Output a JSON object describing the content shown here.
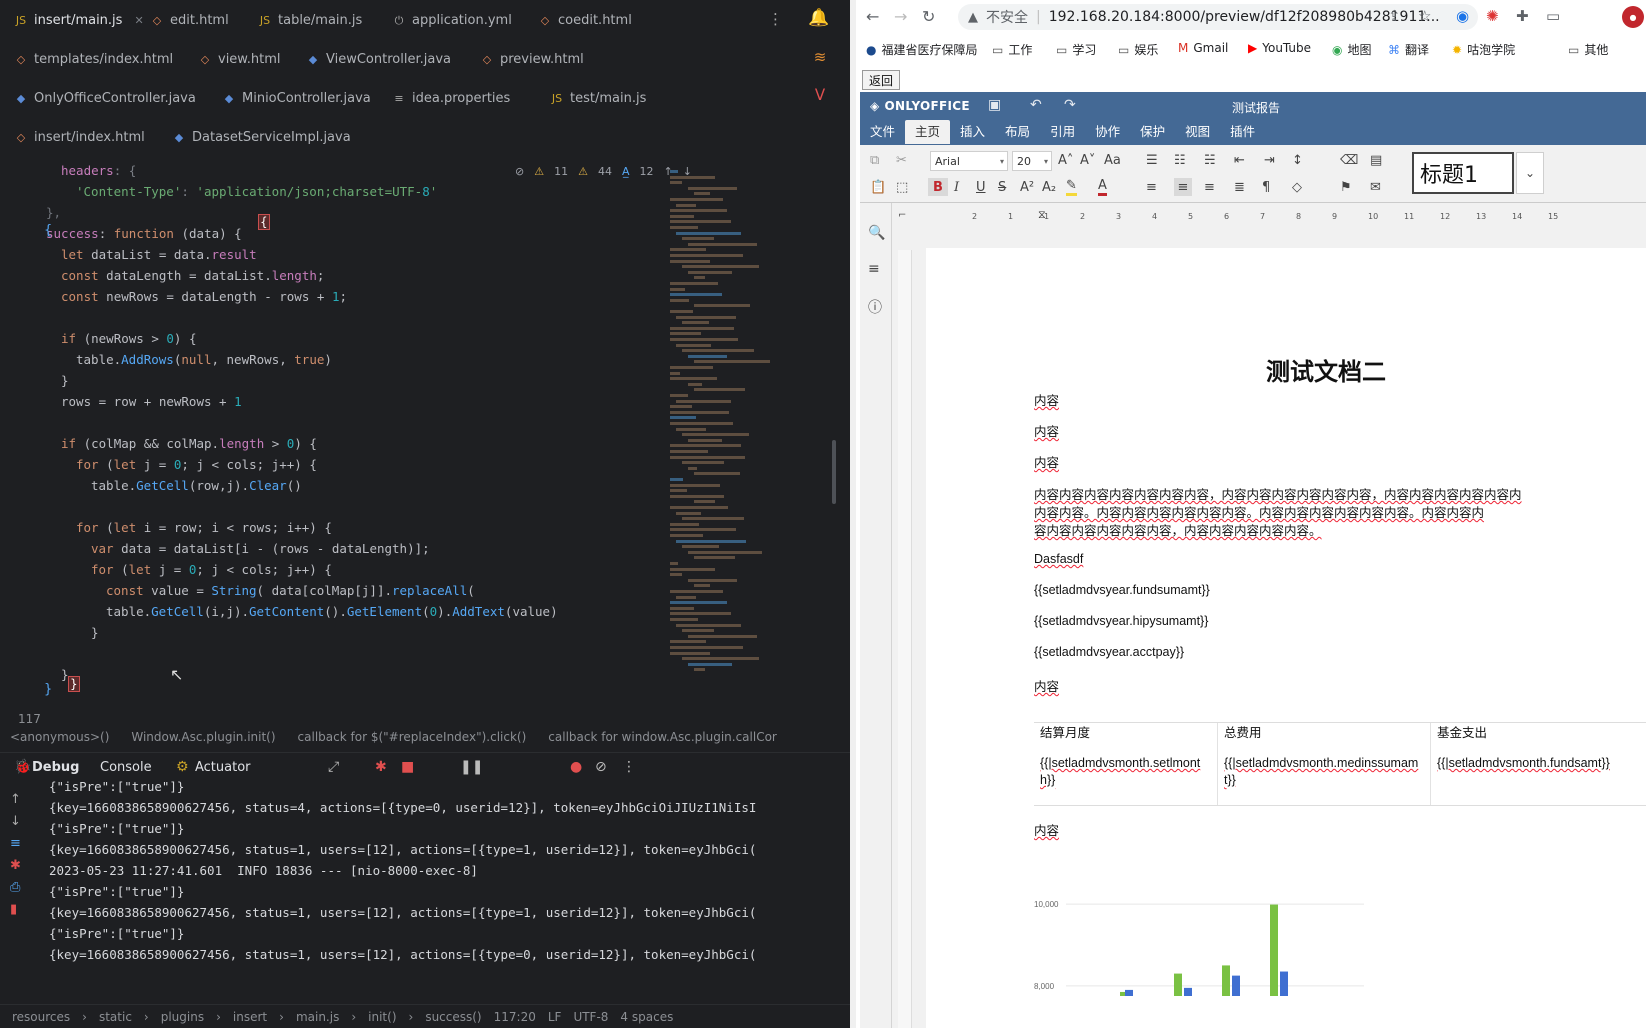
{
  "ide": {
    "tabs_row1": [
      {
        "label": "insert/main.js",
        "icon": "js-file-icon",
        "active": true
      },
      {
        "label": "edit.html",
        "icon": "html-file-icon"
      },
      {
        "label": "table/main.js",
        "icon": "js-file-icon"
      },
      {
        "label": "application.yml",
        "icon": "yml-file-icon"
      },
      {
        "label": "coedit.html",
        "icon": "html-file-icon"
      }
    ],
    "tabs_row2": [
      {
        "label": "templates/index.html",
        "icon": "html-file-icon"
      },
      {
        "label": "view.html",
        "icon": "html-file-icon"
      },
      {
        "label": "ViewController.java",
        "icon": "java-file-icon"
      },
      {
        "label": "preview.html",
        "icon": "html-file-icon"
      }
    ],
    "tabs_row3": [
      {
        "label": "OnlyOfficeController.java",
        "icon": "java-file-icon"
      },
      {
        "label": "MinioController.java",
        "icon": "java-file-icon"
      },
      {
        "label": "idea.properties",
        "icon": "properties-file-icon"
      },
      {
        "label": "test/main.js",
        "icon": "js-file-icon"
      }
    ],
    "tabs_row4": [
      {
        "label": "insert/index.html",
        "icon": "html-file-icon"
      },
      {
        "label": "DatasetServiceImpl.java",
        "icon": "java-file-icon"
      }
    ],
    "inspections": {
      "warnings": "11",
      "weak_warnings": "44",
      "typos": "12"
    },
    "code_lines": [
      "headers: {",
      "'Content-Type': 'application/json;charset=UTF-8'",
      "},",
      "success: function (data) {",
      "let dataList = data.result",
      "const dataLength = dataList.length;",
      "const newRows = dataLength - rows + 1;",
      "",
      "if (newRows > 0) {",
      "table.AddRows(null, newRows, true)",
      "}",
      "rows = row + newRows + 1",
      "",
      "if (colMap && colMap.length > 0) {",
      "for (let j = 0; j < cols; j++) {",
      "table.GetCell(row,j).Clear()",
      "",
      "for (let i = row; i < rows; i++) {",
      "var data = dataList[i - (rows - dataLength)];",
      "for (let j = 0; j < cols; j++) {",
      "const value = String( data[colMap[j]].replaceAll(",
      "table.GetCell(i,j).GetContent().GetElement(0).AddText(value)",
      "}",
      "",
      "}"
    ],
    "line_number": "117",
    "breadcrumbs": [
      "<anonymous>()",
      "Window.Asc.plugin.init()",
      "callback for $(\"#replaceIndex\").click()",
      "callback for window.Asc.plugin.callCor"
    ],
    "toolwindow_tabs": [
      "Debug",
      "Console",
      "Actuator"
    ],
    "console_lines": [
      "{\"isPre\":[\"true\"]}",
      "{key=1660838658900627456, status=4, actions=[{type=0, userid=12}], token=eyJhbGciOiJIUzI1NiIsI",
      "{\"isPre\":[\"true\"]}",
      "{key=1660838658900627456, status=1, users=[12], actions=[{type=1, userid=12}], token=eyJhbGci(",
      "2023-05-23 11:27:41.601  INFO 18836 --- [nio-8000-exec-8]",
      "{\"isPre\":[\"true\"]}",
      "{key=1660838658900627456, status=1, users=[12], actions=[{type=1, userid=12}], token=eyJhbGci(",
      "{\"isPre\":[\"true\"]}",
      "{key=1660838658900627456, status=1, users=[12], actions=[{type=0, userid=12}], token=eyJhbGci("
    ],
    "status_bar": [
      "resources",
      "static",
      "plugins",
      "insert",
      "main.js",
      "init()",
      "success()",
      "117:20",
      "LF",
      "UTF-8",
      "4 spaces"
    ]
  },
  "browser": {
    "security_label": "不安全",
    "url": "192.168.20.184:8000/preview/df12f208980b4281911...",
    "bookmarks": [
      "福建省医疗保障局",
      "工作",
      "学习",
      "娱乐",
      "Gmail",
      "YouTube",
      "地图",
      "翻译",
      "咕泡学院",
      "其他"
    ],
    "back_button": "返回"
  },
  "onlyoffice": {
    "logo": "ONLYOFFICE",
    "doc_title": "测试报告",
    "menus": [
      "文件",
      "主页",
      "插入",
      "布局",
      "引用",
      "协作",
      "保护",
      "视图",
      "插件"
    ],
    "active_menu": "主页",
    "font_name": "Arial",
    "font_size": "20",
    "style_name": "标题1",
    "document": {
      "title": "测试文档二",
      "paragraphs": [
        "内容",
        "内容",
        "内容"
      ],
      "long_lines": [
        "内容内容内容内容内容内容内容，内容内容内容内容内容内容，内容内容内容内容内容内",
        "内容内容。内容内容内容内容内容内容。内容内容内容内容内容内容。内容内容内",
        "容内容内容内容内容内容，内容内容内容内容内容。"
      ],
      "text_a": "Dasfasdf",
      "placeholders": [
        "{{setladmdvsyear.fundsumamt}}",
        "{{setladmdvsyear.hipysumamt}}",
        "{{setladmdvsyear.acctpay}}"
      ],
      "text_b": "内容",
      "table_headers": [
        "结算月度",
        "总费用",
        "基金支出"
      ],
      "table_cells": [
        "{{|setladmdvsmonth.setlmonth}}",
        "{{|setladmdvsmonth.medinssumamt}}",
        "{{|setladmdvsmonth.fundsamt}}"
      ],
      "text_c": "内容"
    }
  },
  "chart_data": {
    "type": "bar",
    "y_ticks": [
      "10,000",
      "8,000"
    ],
    "ylim": [
      7800,
      10200
    ],
    "series": [
      {
        "values": [
          7850,
          8300,
          8500,
          9990
        ],
        "color": "#7ac143"
      },
      {
        "values": [
          7900,
          7950,
          8250,
          8350
        ],
        "color": "#3f6fd1"
      }
    ]
  }
}
